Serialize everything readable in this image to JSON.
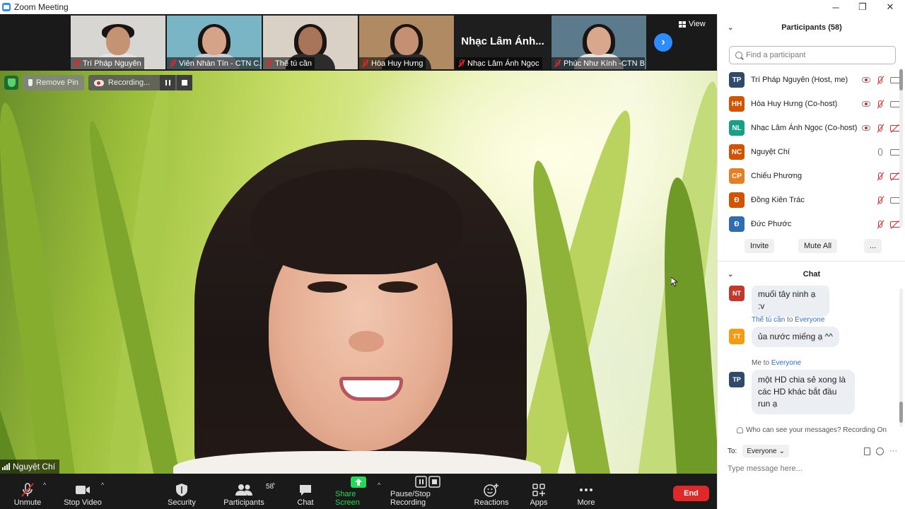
{
  "window": {
    "title": "Zoom Meeting",
    "controls": [
      "─",
      "❐",
      "✕"
    ]
  },
  "thumbnails": [
    {
      "name": "Trí Pháp Nguyên",
      "bg": "#d8d6d2",
      "shirt": "#e4e4e6",
      "skin": "#c49373"
    },
    {
      "name": "Viên Nhàn Tín - CTN C...",
      "bg": "#7ab5c5",
      "shirt": "#c9cfd6",
      "skin": "#d5a387"
    },
    {
      "name": "Thế tú cần",
      "bg": "#d9d1c6",
      "shirt": "#2c2c2c",
      "skin": "#a8745a"
    },
    {
      "name": "Hòa Huy Hưng",
      "bg": "#b08a63",
      "shirt": "#2c2c2c",
      "skin": "#c48f72"
    },
    {
      "name": "Nhạc Lâm Ánh Ngọc",
      "big_name": "Nhạc Lâm Ánh..."
    },
    {
      "name": "Phúc Như Kính -CTN B...",
      "bg": "#5b7a8c",
      "shirt": "#e2e2e2",
      "skin": "#d9a88c"
    }
  ],
  "view_label": "View",
  "next_page_glyph": "›",
  "pin_controls": {
    "remove_pin": "Remove Pin",
    "recording": "Recording..."
  },
  "active_speaker": "Nguyệt Chí",
  "toolbar": {
    "unmute": "Unmute",
    "stop_video": "Stop Video",
    "security": "Security",
    "participants": "Participants",
    "participants_count": "58",
    "chat": "Chat",
    "share_screen": "Share Screen",
    "pause_stop_recording": "Pause/Stop Recording",
    "reactions": "Reactions",
    "apps": "Apps",
    "more": "More",
    "end": "End"
  },
  "panel": {
    "participants_header": "Participants (58)",
    "find_placeholder": "Find a participant",
    "participants": [
      {
        "initials": "TP",
        "color": "#2f4a6b",
        "name": "Trí Pháp Nguyên (Host, me)",
        "recording": true,
        "mic": "off",
        "cam": "on"
      },
      {
        "initials": "HH",
        "color": "#d35400",
        "name": "Hòa Huy Hưng (Co-host)",
        "recording": true,
        "mic": "off",
        "cam": "on"
      },
      {
        "initials": "NL",
        "color": "#16a085",
        "name": "Nhạc Lâm Ánh Ngọc (Co-host)",
        "recording": true,
        "mic": "off",
        "cam": "off"
      },
      {
        "initials": "NC",
        "color": "#d35400",
        "name": "Nguyệt Chí",
        "recording": false,
        "mic": "on",
        "cam": "on"
      },
      {
        "initials": "CP",
        "color": "#e67e22",
        "name": "Chiếu Phương",
        "recording": false,
        "mic": "off",
        "cam": "off"
      },
      {
        "initials": "Đ",
        "color": "#d35400",
        "name": "Đồng Kiên Trác",
        "recording": false,
        "mic": "off",
        "cam": "on"
      },
      {
        "initials": "Đ",
        "color": "#2e6db4",
        "name": "Đức Phước",
        "recording": false,
        "mic": "off",
        "cam": "off"
      }
    ],
    "invite": "Invite",
    "mute_all": "Mute All",
    "more": "...",
    "chat_header": "Chat",
    "messages": [
      {
        "initials": "NT",
        "color": "#c0392b",
        "sender": "",
        "to": "",
        "target": "",
        "text": "muối tây ninh ạ :v"
      },
      {
        "initials": "TT",
        "color": "#f39c12",
        "sender": "Thế tú cần",
        "to": "to",
        "target": "Everyone",
        "text": "ủa nước miếng ạ ^^"
      },
      {
        "initials": "TP",
        "color": "#2f4a6b",
        "sender": "Me",
        "to": "to",
        "target": "Everyone",
        "text": "một HD chia sẻ xong là các HD khác bắt đầu run ạ"
      }
    ],
    "privacy": "Who can see your messages? Recording On",
    "to_label": "To:",
    "to_value": "Everyone",
    "message_placeholder": "Type message here..."
  }
}
